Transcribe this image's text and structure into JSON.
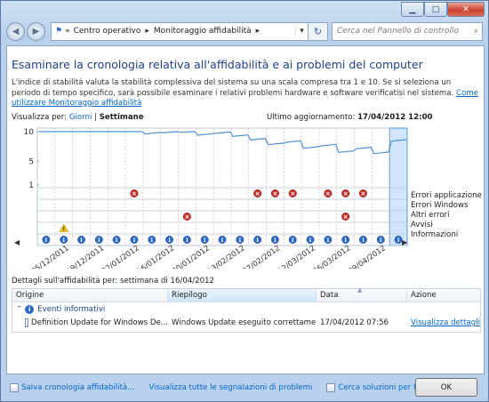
{
  "window": {
    "minimize": "▁",
    "maximize": "□",
    "close": "✕"
  },
  "nav": {
    "back": "◀",
    "forward": "▶",
    "prefix": "«",
    "crumbs": [
      "Centro operativo",
      "Monitoraggio affidabilità"
    ],
    "separator": "▸",
    "dropdown": "▾",
    "refresh": "↻",
    "search_placeholder": "Cerca nel Pannello di controllo",
    "search_icon": "⌕"
  },
  "title": "Esaminare la cronologia relativa all'affidabilità e ai problemi del computer",
  "description": "L'indice di stabilità valuta la stabilità complessiva del sistema su una scala compresa tra 1 e 10. Se si seleziona un periodo di tempo specifico, sarà possibile esaminare i relativi problemi hardware e software verificatisi nel sistema.",
  "description_link": "Come utilizzare Monitoraggio affidabilità",
  "view_by": {
    "label": "Visualizza per:",
    "days": "Giorni",
    "sep": "|",
    "weeks": "Settimane"
  },
  "last_update": {
    "label": "Ultimo aggiornamento:",
    "value": "17/04/2012 12:00"
  },
  "legend": [
    "Errori applicazione",
    "Errori Windows",
    "Altri errori",
    "Avvisi",
    "Informazioni"
  ],
  "chart_data": {
    "type": "line",
    "y_ticks": [
      "10",
      "5",
      "1"
    ],
    "ylim": [
      1,
      10
    ],
    "x_labels": [
      "05/12/2011",
      "19/12/2011",
      "02/01/2012",
      "16/01/2012",
      "30/01/2012",
      "13/02/2012",
      "27/02/2012",
      "12/03/2012",
      "26/03/2012",
      "09/04/2012"
    ],
    "num_columns": 21,
    "stability": [
      10,
      10,
      10,
      10,
      10,
      10,
      9.6,
      9.8,
      9.9,
      9.4,
      9.7,
      9.2,
      8.6,
      7.8,
      8.2,
      7.2,
      7.6,
      6.5,
      7.1,
      6.3,
      8.4
    ],
    "app_error_cols": [
      5,
      12,
      13,
      14,
      16,
      17,
      18
    ],
    "windows_error_cols": [],
    "other_error_cols": [
      8,
      17
    ],
    "warning_cols": [
      1
    ],
    "info_cols": [
      0,
      1,
      2,
      3,
      4,
      5,
      6,
      7,
      8,
      9,
      10,
      11,
      12,
      13,
      14,
      15,
      16,
      17,
      18,
      19,
      20
    ],
    "selected_col": 20
  },
  "details_label": "Dettagli sull'affidabilità per: settimana di 16/04/2012",
  "grid": {
    "columns": [
      "Origine",
      "Riepilogo",
      "Data",
      "Azione"
    ],
    "group": "Eventi informativi",
    "group_toggle": "⌃",
    "rows": [
      {
        "source": "Definition Update for Windows De...",
        "summary": "Windows Update eseguito correttamente",
        "date": "17/04/2012 07:56",
        "action": "Visualizza dettagli..."
      }
    ]
  },
  "footer": {
    "save": "Salva cronologia affidabilità...",
    "view_all": "Visualizza tutte le segnalazioni di problemi",
    "check": "Cerca soluzioni per tutti i problemi...",
    "ok": "OK"
  }
}
